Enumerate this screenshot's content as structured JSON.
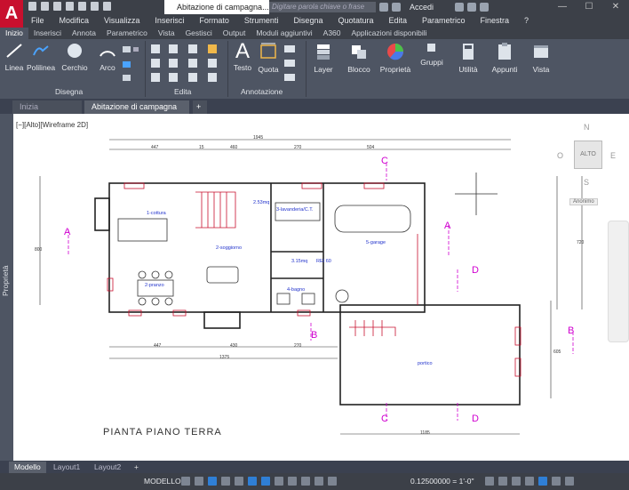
{
  "app": {
    "logo": "A",
    "doc_title": "Abitazione di campagna...",
    "search_placeholder": "Digitare parola chiave o frase",
    "login": "Accedi"
  },
  "menu": [
    "File",
    "Modifica",
    "Visualizza",
    "Inserisci",
    "Formato",
    "Strumenti",
    "Disegna",
    "Quotatura",
    "Edita",
    "Parametrico",
    "Finestra",
    "?"
  ],
  "ribbon_tabs": [
    "Inizio",
    "Inserisci",
    "Annota",
    "Parametrico",
    "Vista",
    "Gestisci",
    "Output",
    "Moduli aggiuntivi",
    "A360",
    "Applicazioni disponibili"
  ],
  "ribbon": {
    "draw": {
      "linea": "Linea",
      "polilinea": "Polilinea",
      "cerchio": "Cerchio",
      "arco": "Arco",
      "panel": "Disegna"
    },
    "edit_panel": "Edita",
    "annot": {
      "testo": "Testo",
      "quota": "Quota",
      "panel": "Annotazione"
    },
    "layer": "Layer",
    "blocco": "Blocco",
    "proprieta": "Proprietà",
    "gruppi": "Gruppi",
    "utilita": "Utilità",
    "appunti": "Appunti",
    "vista": "Vista"
  },
  "doc_tabs": {
    "start": "Inizia",
    "active": "Abitazione di campagna"
  },
  "viewport": {
    "label": "[−][Alto][Wireframe 2D]",
    "viewcube_top": "ALTO",
    "compass": {
      "n": "N",
      "s": "S",
      "e": "E",
      "o": "O"
    },
    "wcs": "Anonimo"
  },
  "side_palette": "Proprietà",
  "drawing": {
    "title": "PIANTA  PIANO  TERRA",
    "rooms": [
      "1-cottura",
      "2-soggiorno",
      "2-pranzo",
      "3-lavanderia/C.T.",
      "4-bagno",
      "5-garage",
      "portico"
    ],
    "areas": [
      "2.53mq",
      "3.15mq"
    ],
    "rei": "REI 60",
    "sections": [
      "A",
      "A",
      "B",
      "B",
      "C",
      "C",
      "D",
      "D"
    ],
    "dims_top": [
      "1945",
      "447",
      "15",
      "460",
      "270",
      "504"
    ],
    "dims_bottom": [
      "447",
      "430",
      "270",
      "1375",
      "1185"
    ],
    "dims_side": [
      "800",
      "720",
      "605"
    ]
  },
  "layout_tabs": [
    "Modello",
    "Layout1",
    "Layout2"
  ],
  "status": {
    "model": "MODELLO",
    "scale": "0.12500000 = 1'-0\""
  }
}
